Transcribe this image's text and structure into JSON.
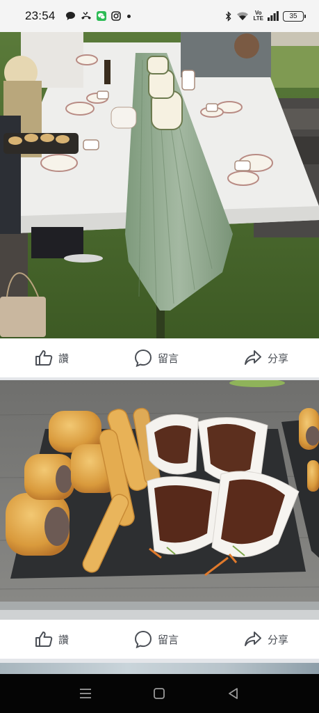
{
  "status_bar": {
    "time": "23:54",
    "left_icons": [
      "chat-bubble-icon",
      "missed-call-icon",
      "wechat-icon",
      "instagram-icon",
      "notification-dot"
    ],
    "right_icons": [
      "bluetooth-icon",
      "wifi-icon",
      "volte-icon",
      "signal-icon",
      "battery-icon"
    ],
    "volte_top": "Vo",
    "volte_bottom": "LTE",
    "battery_level": "35"
  },
  "posts": [
    {
      "image_alt": "Outdoor afternoon tea table with green runner, floral teacups and tiered cake stands",
      "actions": {
        "like": "讚",
        "comment": "留言",
        "share": "分享"
      }
    },
    {
      "image_alt": "Slate board with sausage rolls, puff pastry twists and pulled-meat bao buns",
      "actions": {
        "like": "讚",
        "comment": "留言",
        "share": "分享"
      }
    }
  ],
  "nav_bar": {
    "buttons": [
      "recent-apps-icon",
      "home-icon",
      "back-icon"
    ]
  },
  "colors": {
    "action_text": "#4b4f56",
    "background": "#e4e6ea",
    "nav_background": "#050505"
  }
}
